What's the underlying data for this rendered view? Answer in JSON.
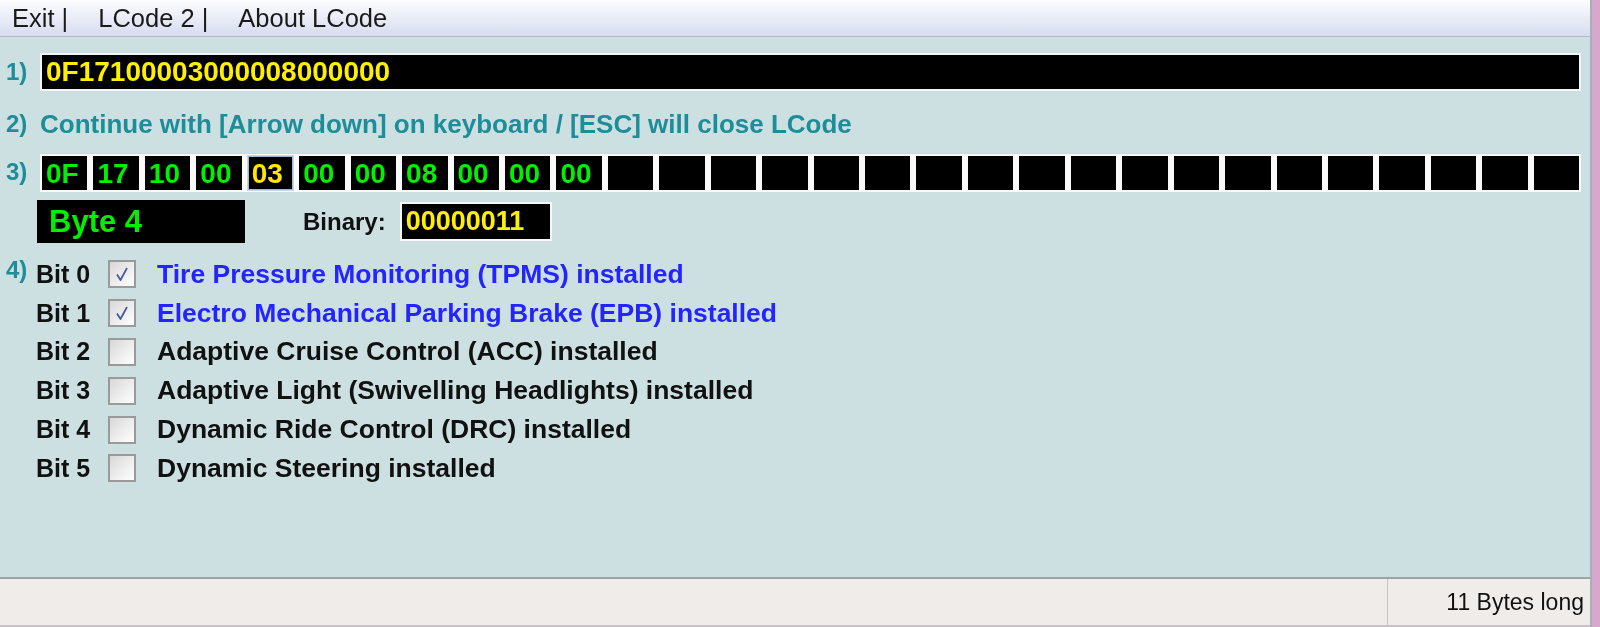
{
  "menu": [
    {
      "label": "Exit |"
    },
    {
      "label": "LCode 2 |"
    },
    {
      "label": "About LCode"
    }
  ],
  "code": {
    "step": "1)",
    "value": "0F17100003000008000000"
  },
  "instruction": {
    "step": "2)",
    "text": "Continue with [Arrow down] on keyboard / [ESC] will close LCode"
  },
  "bytes": {
    "step": "3)",
    "cells": [
      {
        "value": "0F",
        "selected": false
      },
      {
        "value": "17",
        "selected": false
      },
      {
        "value": "10",
        "selected": false
      },
      {
        "value": "00",
        "selected": false
      },
      {
        "value": "03",
        "selected": true
      },
      {
        "value": "00",
        "selected": false
      },
      {
        "value": "00",
        "selected": false
      },
      {
        "value": "08",
        "selected": false
      },
      {
        "value": "00",
        "selected": false
      },
      {
        "value": "00",
        "selected": false
      },
      {
        "value": "00",
        "selected": false
      },
      {
        "selected": false
      },
      {
        "selected": false
      },
      {
        "selected": false
      },
      {
        "selected": false
      },
      {
        "selected": false
      },
      {
        "selected": false
      },
      {
        "selected": false
      },
      {
        "selected": false
      },
      {
        "selected": false
      },
      {
        "selected": false
      },
      {
        "selected": false
      },
      {
        "selected": false
      },
      {
        "selected": false
      },
      {
        "selected": false
      },
      {
        "selected": false
      },
      {
        "selected": false
      },
      {
        "selected": false
      },
      {
        "selected": false
      },
      {
        "selected": false
      }
    ]
  },
  "byte_info": {
    "title": "Byte 4",
    "binary_label": "Binary:",
    "binary_value": "00000011"
  },
  "bits": {
    "step": "4)",
    "items": [
      {
        "bit": "Bit 0",
        "checked": true,
        "label": "Tire Pressure Monitoring (TPMS) installed"
      },
      {
        "bit": "Bit 1",
        "checked": true,
        "label": "Electro Mechanical Parking Brake (EPB) installed"
      },
      {
        "bit": "Bit 2",
        "checked": false,
        "label": "Adaptive Cruise Control (ACC) installed"
      },
      {
        "bit": "Bit 3",
        "checked": false,
        "label": "Adaptive Light (Swivelling Headlights) installed"
      },
      {
        "bit": "Bit 4",
        "checked": false,
        "label": "Dynamic Ride Control (DRC) installed"
      },
      {
        "bit": "Bit 5",
        "checked": false,
        "label": "Dynamic Steering installed"
      }
    ]
  },
  "status_bar": {
    "text": "11 Bytes long"
  }
}
